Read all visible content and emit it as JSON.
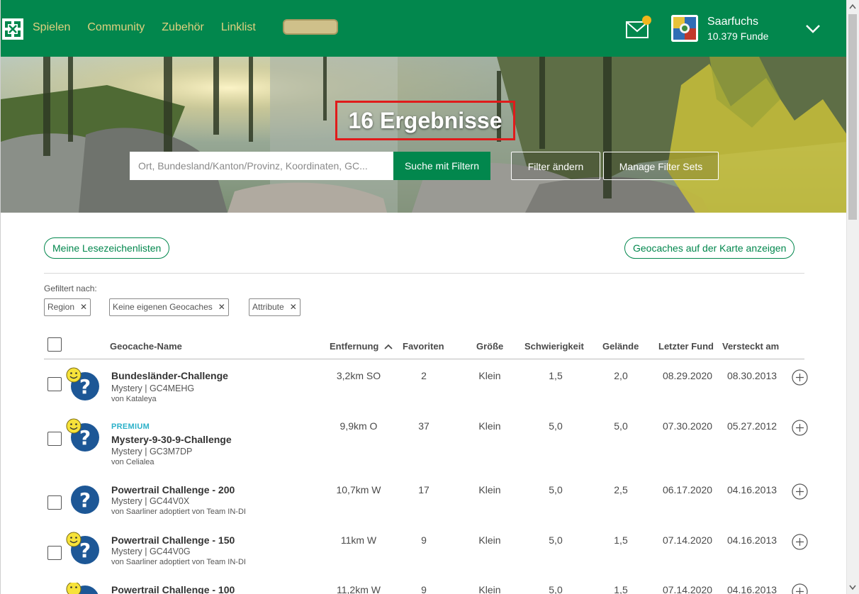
{
  "nav": {
    "items": [
      "Spielen",
      "Community",
      "Zubehör",
      "Linklist"
    ]
  },
  "user": {
    "name": "Saarfuchs",
    "finds": "10.379 Funde"
  },
  "hero": {
    "title": "16 Ergebnisse",
    "search_placeholder": "Ort, Bundesland/Kanton/Provinz, Koordinaten, GC...",
    "search_button": "Suche mit Filtern",
    "filter_button": "Filter ändern",
    "filtersets_button": "Manage Filter Sets"
  },
  "actions": {
    "bookmarks": "Meine Lesezeichenlisten",
    "map": "Geocaches auf der Karte anzeigen"
  },
  "filters": {
    "label": "Gefiltert nach:",
    "chips": [
      "Region",
      "Keine eigenen Geocaches",
      "Attribute"
    ]
  },
  "table": {
    "headers": [
      "Geocache-Name",
      "Entfernung",
      "Favoriten",
      "Größe",
      "Schwierigkeit",
      "Gelände",
      "Letzter Fund",
      "Versteckt am"
    ],
    "rows": [
      {
        "premium": "",
        "name": "Bundesländer-Challenge",
        "type": "Mystery | GC4MEHG",
        "owner": "von Kataleya",
        "distance": "3,2km SO",
        "favorites": "2",
        "size": "Klein",
        "difficulty": "1,5",
        "terrain": "2,0",
        "last_found": "08.29.2020",
        "hidden": "08.30.2013"
      },
      {
        "premium": "PREMIUM",
        "name": "Mystery-9-30-9-Challenge",
        "type": "Mystery | GC3M7DP",
        "owner": "von Celialea",
        "distance": "9,9km O",
        "favorites": "37",
        "size": "Klein",
        "difficulty": "5,0",
        "terrain": "5,0",
        "last_found": "07.30.2020",
        "hidden": "05.27.2012"
      },
      {
        "premium": "",
        "name": "Powertrail Challenge - 200",
        "type": "Mystery | GC44V0X",
        "owner": "von Saarliner adoptiert von Team IN-DI",
        "distance": "10,7km W",
        "favorites": "17",
        "size": "Klein",
        "difficulty": "5,0",
        "terrain": "2,5",
        "last_found": "06.17.2020",
        "hidden": "04.16.2013"
      },
      {
        "premium": "",
        "name": "Powertrail Challenge - 150",
        "type": "Mystery | GC44V0G",
        "owner": "von Saarliner adoptiert von Team IN-DI",
        "distance": "11km W",
        "favorites": "9",
        "size": "Klein",
        "difficulty": "5,0",
        "terrain": "1,5",
        "last_found": "07.14.2020",
        "hidden": "04.16.2013"
      },
      {
        "premium": "",
        "name": "Powertrail Challenge - 100",
        "type": "",
        "owner": "",
        "distance": "11,2km W",
        "favorites": "9",
        "size": "Klein",
        "difficulty": "5,0",
        "terrain": "1,5",
        "last_found": "07.14.2020",
        "hidden": "04.16.2013"
      }
    ]
  },
  "colors": {
    "brand": "#02874d",
    "nav_text": "#e0d07f",
    "premium": "#2cb1c9",
    "highlight": "#e01b1b"
  }
}
